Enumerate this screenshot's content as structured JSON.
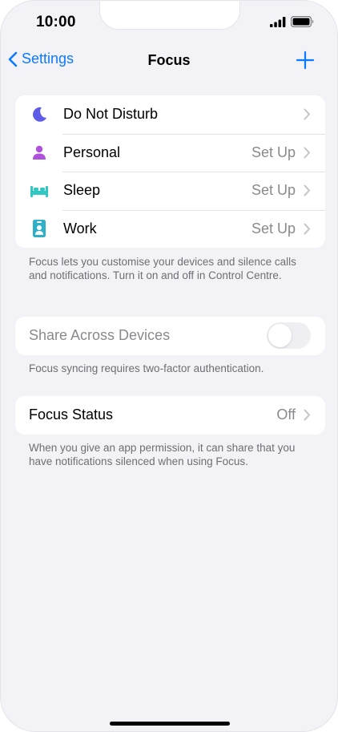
{
  "status_bar": {
    "time": "10:00"
  },
  "nav": {
    "back_label": "Settings",
    "title": "Focus"
  },
  "focus_modes": [
    {
      "name": "Do Not Disturb",
      "value": "",
      "icon": "moon-icon",
      "color": "#5e5ce6"
    },
    {
      "name": "Personal",
      "value": "Set Up",
      "icon": "person-icon",
      "color": "#af52de"
    },
    {
      "name": "Sleep",
      "value": "Set Up",
      "icon": "bed-icon",
      "color": "#30c8c0"
    },
    {
      "name": "Work",
      "value": "Set Up",
      "icon": "id-badge-icon",
      "color": "#30b0c7"
    }
  ],
  "focus_footer": "Focus lets you customise your devices and silence calls and notifications. Turn it on and off in Control Centre.",
  "share": {
    "label": "Share Across Devices",
    "enabled": false,
    "footer": "Focus syncing requires two-factor authentication."
  },
  "focus_status": {
    "label": "Focus Status",
    "value": "Off",
    "footer": "When you give an app permission, it can share that you have notifications silenced when using Focus."
  },
  "colors": {
    "accent": "#0a7aff",
    "background": "#f2f2f7",
    "secondary_text": "#8a8a8e"
  }
}
